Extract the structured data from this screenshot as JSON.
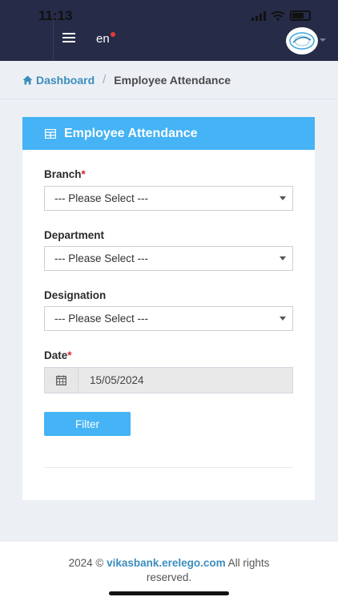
{
  "status_bar": {
    "time": "11:13"
  },
  "topbar": {
    "lang_label": "en"
  },
  "breadcrumb": {
    "home_label": "Dashboard",
    "current_label": "Employee Attendance"
  },
  "card": {
    "title": "Employee Attendance"
  },
  "form": {
    "branch": {
      "label": "Branch",
      "required": "*",
      "value": "--- Please Select ---"
    },
    "department": {
      "label": "Department",
      "value": "--- Please Select ---"
    },
    "designation": {
      "label": "Designation",
      "value": "--- Please Select ---"
    },
    "date": {
      "label": "Date",
      "required": "*",
      "value": "15/05/2024"
    },
    "filter_label": "Filter"
  },
  "footer": {
    "prefix": "2024 © ",
    "brand": "vikasbank.erelego.com",
    "suffix": " All rights reserved."
  },
  "colors": {
    "topbar": "#262b48",
    "accent": "#45b3f5",
    "link": "#3c8dbc",
    "required": "#d9232d"
  },
  "icons": [
    "menu-icon",
    "notification-dot-icon",
    "home-icon",
    "table-icon",
    "calendar-icon",
    "chevron-down-icon"
  ]
}
